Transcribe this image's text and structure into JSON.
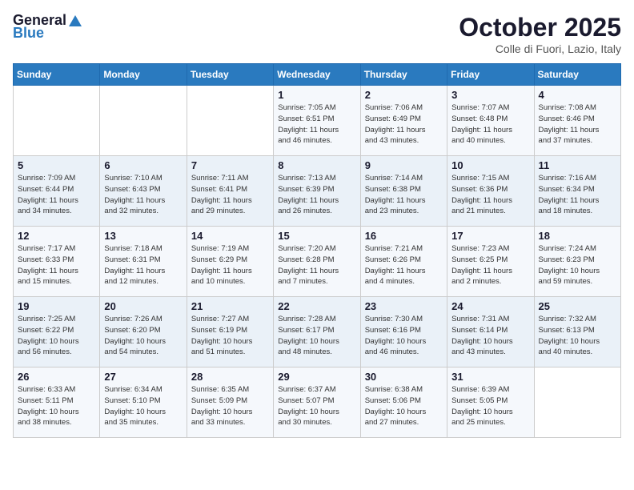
{
  "logo": {
    "line1": "General",
    "line2": "Blue"
  },
  "title": "October 2025",
  "subtitle": "Colle di Fuori, Lazio, Italy",
  "days_of_week": [
    "Sunday",
    "Monday",
    "Tuesday",
    "Wednesday",
    "Thursday",
    "Friday",
    "Saturday"
  ],
  "weeks": [
    [
      {
        "day": "",
        "info": ""
      },
      {
        "day": "",
        "info": ""
      },
      {
        "day": "",
        "info": ""
      },
      {
        "day": "1",
        "info": "Sunrise: 7:05 AM\nSunset: 6:51 PM\nDaylight: 11 hours\nand 46 minutes."
      },
      {
        "day": "2",
        "info": "Sunrise: 7:06 AM\nSunset: 6:49 PM\nDaylight: 11 hours\nand 43 minutes."
      },
      {
        "day": "3",
        "info": "Sunrise: 7:07 AM\nSunset: 6:48 PM\nDaylight: 11 hours\nand 40 minutes."
      },
      {
        "day": "4",
        "info": "Sunrise: 7:08 AM\nSunset: 6:46 PM\nDaylight: 11 hours\nand 37 minutes."
      }
    ],
    [
      {
        "day": "5",
        "info": "Sunrise: 7:09 AM\nSunset: 6:44 PM\nDaylight: 11 hours\nand 34 minutes."
      },
      {
        "day": "6",
        "info": "Sunrise: 7:10 AM\nSunset: 6:43 PM\nDaylight: 11 hours\nand 32 minutes."
      },
      {
        "day": "7",
        "info": "Sunrise: 7:11 AM\nSunset: 6:41 PM\nDaylight: 11 hours\nand 29 minutes."
      },
      {
        "day": "8",
        "info": "Sunrise: 7:13 AM\nSunset: 6:39 PM\nDaylight: 11 hours\nand 26 minutes."
      },
      {
        "day": "9",
        "info": "Sunrise: 7:14 AM\nSunset: 6:38 PM\nDaylight: 11 hours\nand 23 minutes."
      },
      {
        "day": "10",
        "info": "Sunrise: 7:15 AM\nSunset: 6:36 PM\nDaylight: 11 hours\nand 21 minutes."
      },
      {
        "day": "11",
        "info": "Sunrise: 7:16 AM\nSunset: 6:34 PM\nDaylight: 11 hours\nand 18 minutes."
      }
    ],
    [
      {
        "day": "12",
        "info": "Sunrise: 7:17 AM\nSunset: 6:33 PM\nDaylight: 11 hours\nand 15 minutes."
      },
      {
        "day": "13",
        "info": "Sunrise: 7:18 AM\nSunset: 6:31 PM\nDaylight: 11 hours\nand 12 minutes."
      },
      {
        "day": "14",
        "info": "Sunrise: 7:19 AM\nSunset: 6:29 PM\nDaylight: 11 hours\nand 10 minutes."
      },
      {
        "day": "15",
        "info": "Sunrise: 7:20 AM\nSunset: 6:28 PM\nDaylight: 11 hours\nand 7 minutes."
      },
      {
        "day": "16",
        "info": "Sunrise: 7:21 AM\nSunset: 6:26 PM\nDaylight: 11 hours\nand 4 minutes."
      },
      {
        "day": "17",
        "info": "Sunrise: 7:23 AM\nSunset: 6:25 PM\nDaylight: 11 hours\nand 2 minutes."
      },
      {
        "day": "18",
        "info": "Sunrise: 7:24 AM\nSunset: 6:23 PM\nDaylight: 10 hours\nand 59 minutes."
      }
    ],
    [
      {
        "day": "19",
        "info": "Sunrise: 7:25 AM\nSunset: 6:22 PM\nDaylight: 10 hours\nand 56 minutes."
      },
      {
        "day": "20",
        "info": "Sunrise: 7:26 AM\nSunset: 6:20 PM\nDaylight: 10 hours\nand 54 minutes."
      },
      {
        "day": "21",
        "info": "Sunrise: 7:27 AM\nSunset: 6:19 PM\nDaylight: 10 hours\nand 51 minutes."
      },
      {
        "day": "22",
        "info": "Sunrise: 7:28 AM\nSunset: 6:17 PM\nDaylight: 10 hours\nand 48 minutes."
      },
      {
        "day": "23",
        "info": "Sunrise: 7:30 AM\nSunset: 6:16 PM\nDaylight: 10 hours\nand 46 minutes."
      },
      {
        "day": "24",
        "info": "Sunrise: 7:31 AM\nSunset: 6:14 PM\nDaylight: 10 hours\nand 43 minutes."
      },
      {
        "day": "25",
        "info": "Sunrise: 7:32 AM\nSunset: 6:13 PM\nDaylight: 10 hours\nand 40 minutes."
      }
    ],
    [
      {
        "day": "26",
        "info": "Sunrise: 6:33 AM\nSunset: 5:11 PM\nDaylight: 10 hours\nand 38 minutes."
      },
      {
        "day": "27",
        "info": "Sunrise: 6:34 AM\nSunset: 5:10 PM\nDaylight: 10 hours\nand 35 minutes."
      },
      {
        "day": "28",
        "info": "Sunrise: 6:35 AM\nSunset: 5:09 PM\nDaylight: 10 hours\nand 33 minutes."
      },
      {
        "day": "29",
        "info": "Sunrise: 6:37 AM\nSunset: 5:07 PM\nDaylight: 10 hours\nand 30 minutes."
      },
      {
        "day": "30",
        "info": "Sunrise: 6:38 AM\nSunset: 5:06 PM\nDaylight: 10 hours\nand 27 minutes."
      },
      {
        "day": "31",
        "info": "Sunrise: 6:39 AM\nSunset: 5:05 PM\nDaylight: 10 hours\nand 25 minutes."
      },
      {
        "day": "",
        "info": ""
      }
    ]
  ]
}
